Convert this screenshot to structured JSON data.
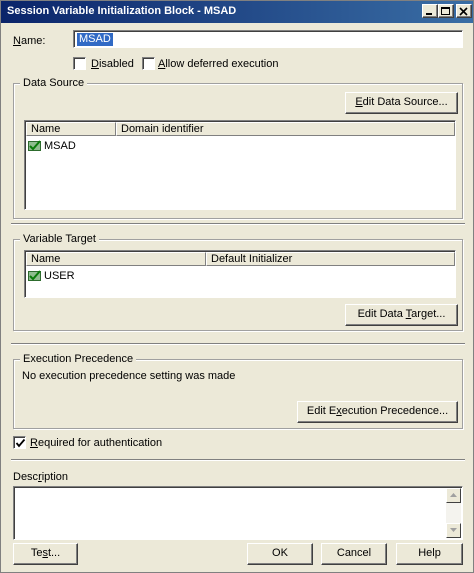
{
  "window": {
    "title": "Session Variable Initialization Block - MSAD"
  },
  "name_field": {
    "label_pre": "",
    "label_ul": "N",
    "label_post": "ame:",
    "value": "MSAD"
  },
  "options": {
    "disabled": {
      "label_pre": "",
      "label_ul": "D",
      "label_post": "isabled",
      "checked": false
    },
    "deferred": {
      "label_pre": "",
      "label_ul": "A",
      "label_post": "llow deferred execution",
      "checked": false
    }
  },
  "data_source": {
    "group_label": "Data Source",
    "edit_button": {
      "pre": "",
      "ul": "E",
      "post": "dit Data Source..."
    },
    "columns": [
      "Name",
      "Domain identifier"
    ],
    "rows": [
      {
        "name": "MSAD",
        "icon": "init-block-icon"
      }
    ]
  },
  "variable_target": {
    "group_label": "Variable Target",
    "columns": [
      "Name",
      "Default Initializer"
    ],
    "rows": [
      {
        "name": "USER",
        "icon": "session-variable-icon"
      }
    ],
    "edit_button": {
      "pre": "Edit Data ",
      "ul": "T",
      "post": "arget..."
    }
  },
  "execution_precedence": {
    "group_label": "Execution Precedence",
    "message": "No execution precedence setting was made",
    "edit_button": {
      "pre": "Edit E",
      "ul": "x",
      "post": "ecution Precedence..."
    }
  },
  "required_auth": {
    "label_pre": "",
    "label_ul": "R",
    "label_post": "equired for authentication",
    "checked": true
  },
  "description": {
    "label_pre": "Desc",
    "label_ul": "r",
    "label_post": "iption",
    "value": ""
  },
  "footer": {
    "test": {
      "pre": "Te",
      "ul": "s",
      "post": "t..."
    },
    "ok": "OK",
    "cancel": "Cancel",
    "help": "Help"
  },
  "icons": {
    "minimize": "minimize-icon",
    "maximize": "maximize-icon",
    "close": "close-icon",
    "check": "checkmark-icon",
    "scroll_up": "scroll-up-arrow-icon",
    "scroll_down": "scroll-down-arrow-icon"
  },
  "colors": {
    "titlebar_start": "#0a246a",
    "titlebar_end": "#3a6ea5",
    "selection": "#316ac5",
    "dialog_face": "#ece9d8"
  }
}
